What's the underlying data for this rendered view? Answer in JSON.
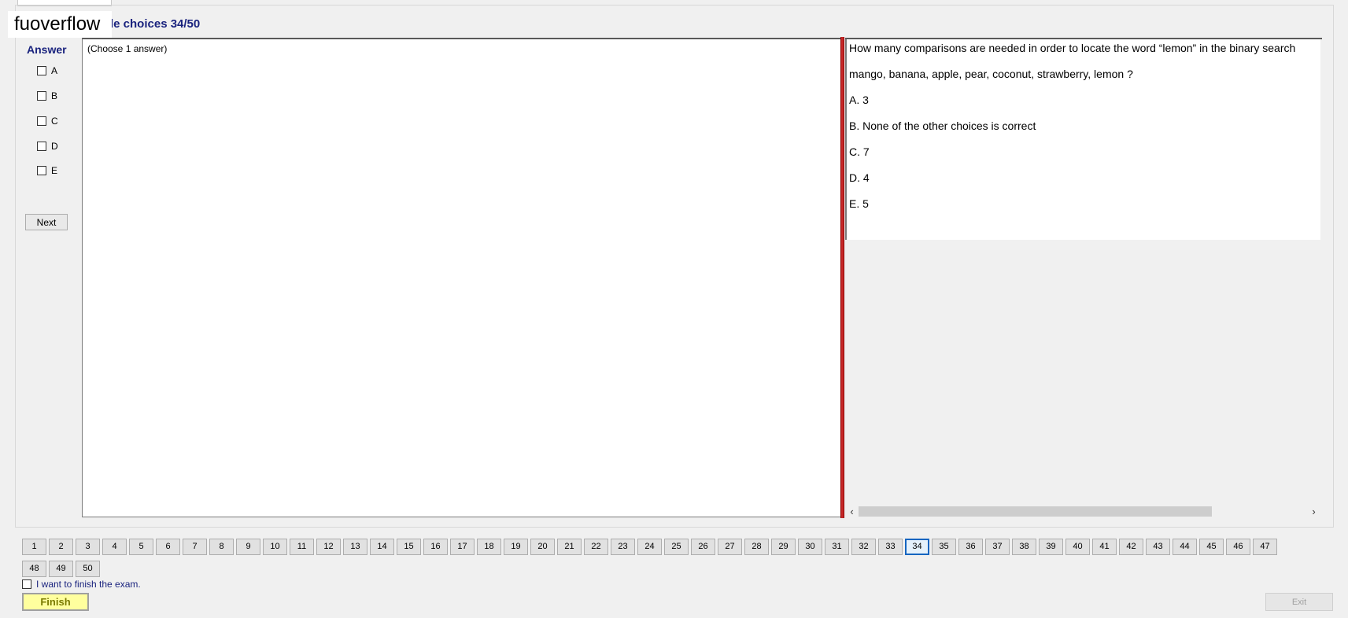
{
  "watermark": "fuoverflow",
  "frame": {
    "title": "le choices 34/50"
  },
  "answer": {
    "title": "Answer",
    "options": [
      "A",
      "B",
      "C",
      "D",
      "E"
    ],
    "next_label": "Next",
    "instruction": "(Choose 1 answer)"
  },
  "question": {
    "lines": [
      "How many comparisons are needed in order to locate the word “lemon” in the binary search",
      "mango, banana, apple, pear, coconut, strawberry, lemon  ?",
      "A.  3",
      "B.  None of the other choices is correct",
      "C.  7",
      "D.  4",
      "E.  5"
    ],
    "scroll_left": "‹",
    "scroll_right": "›"
  },
  "navigation": {
    "current": 34,
    "numbers": [
      "1",
      "2",
      "3",
      "4",
      "5",
      "6",
      "7",
      "8",
      "9",
      "10",
      "11",
      "12",
      "13",
      "14",
      "15",
      "16",
      "17",
      "18",
      "19",
      "20",
      "21",
      "22",
      "23",
      "24",
      "25",
      "26",
      "27",
      "28",
      "29",
      "30",
      "31",
      "32",
      "33",
      "34",
      "35",
      "36",
      "37",
      "38",
      "39",
      "40",
      "41",
      "42",
      "43",
      "44",
      "45",
      "46",
      "47",
      "48",
      "49",
      "50"
    ]
  },
  "footer": {
    "finish_check_label": "I want to finish the exam.",
    "finish_label": "Finish",
    "exit_label": "Exit"
  }
}
